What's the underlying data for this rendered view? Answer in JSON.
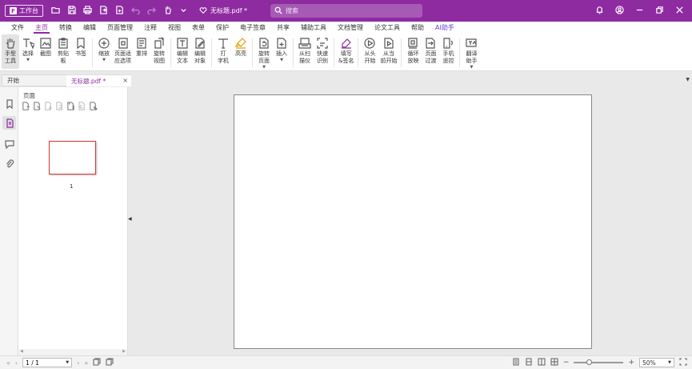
{
  "titlebar": {
    "workspace_label": "工作台",
    "doc_title": "无标题.pdf *",
    "search_placeholder": "搜索"
  },
  "menu": {
    "tabs": [
      "文件",
      "主页",
      "转换",
      "编辑",
      "页面管理",
      "注释",
      "视图",
      "表单",
      "保护",
      "电子签章",
      "共享",
      "辅助工具",
      "文档管理",
      "论文工具",
      "帮助",
      "AI助手"
    ],
    "active_index": 1
  },
  "ribbon": {
    "hand": "手型\n工具",
    "select": "选择",
    "snapshot": "截图",
    "clipboard": "剪贴\n板",
    "bookmark": "书签",
    "zoom": "缩放",
    "fit_page": "页面适\n应选项",
    "reflow": "重排",
    "rotate_view": "旋转\n视图",
    "edit_text": "编辑\n文本",
    "edit_object": "编辑\n对象",
    "typewriter": "打\n字机",
    "highlight": "高亮",
    "rotate_page": "旋转\n页面",
    "insert": "插入",
    "from_scanner": "从扫\n描仪",
    "quick_ocr": "快速\n识别",
    "fill_sign": "填写\n&签名",
    "from_start": "从头\n开始",
    "from_current": "从当\n前开始",
    "loop_play": "循环\n放映",
    "page_transition": "页面\n过渡",
    "phone_remote": "手机\n遥控",
    "translate": "翻译\n助手"
  },
  "tabs": {
    "home": "开始",
    "doc": "无标题.pdf *",
    "close": "×"
  },
  "thumbnails": {
    "header": "页面",
    "page_number": "1"
  },
  "statusbar": {
    "page_value": "1 / 1",
    "zoom_value": "50%",
    "zoom_minus": "−",
    "zoom_plus": "+"
  },
  "colors": {
    "accent": "#8e2ba1",
    "ai": "#6b3fe0"
  }
}
